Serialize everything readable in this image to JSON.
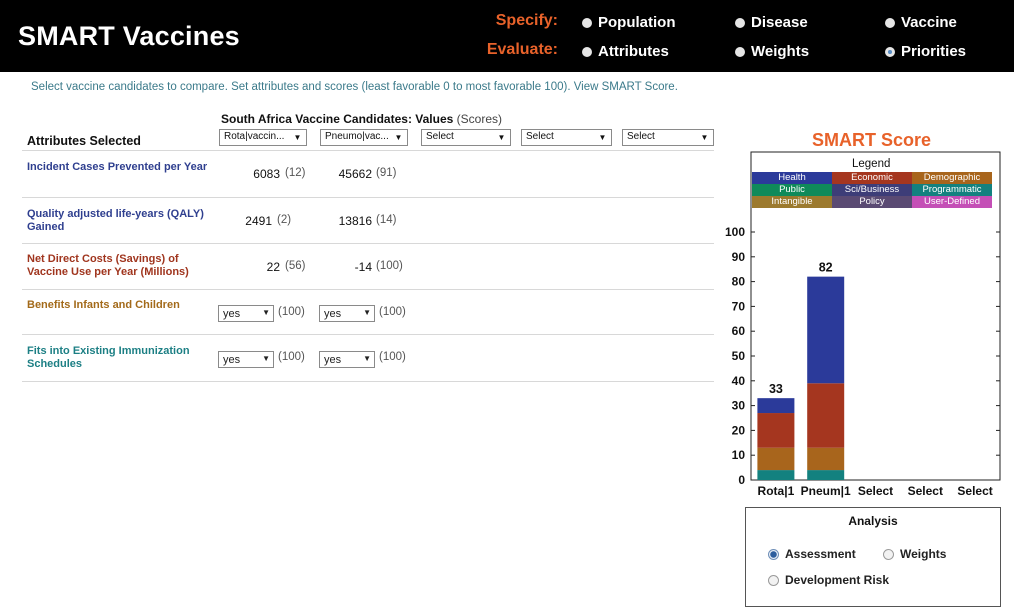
{
  "header": {
    "title": "SMART Vaccines",
    "specify_label": "Specify:",
    "evaluate_label": "Evaluate:",
    "specify_items": [
      "Population",
      "Disease",
      "Vaccine"
    ],
    "evaluate_items": [
      "Attributes",
      "Weights",
      "Priorities"
    ],
    "selected": "Priorities"
  },
  "instructions": "Select vaccine candidates to compare. Set attributes and scores (least favorable 0 to most favorable 100). View SMART Score.",
  "table": {
    "title": "South Africa Vaccine Candidates: Values",
    "title_sub": "(Scores)",
    "attributes_header": "Attributes Selected",
    "candidate_selects": [
      "Rota|vaccin...",
      "Pneumo|vac...",
      "Select",
      "Select",
      "Select"
    ],
    "rows": [
      {
        "label": "Incident Cases Prevented per Year",
        "color": "#2f3f8f",
        "v1": "6083",
        "s1": "(12)",
        "v2": "45662",
        "s2": "(91)"
      },
      {
        "label": "Quality adjusted life-years (QALY) Gained",
        "color": "#2f3f8f",
        "v1": "2491",
        "s1": "(2)",
        "v2": "13816",
        "s2": "(14)"
      },
      {
        "label": "Net Direct Costs (Savings) of Vaccine Use per Year (Millions)",
        "color": "#a0351e",
        "v1": "22",
        "s1": "(56)",
        "v2": "-14",
        "s2": "(100)"
      },
      {
        "label": "Benefits Infants and Children",
        "color": "#a36a1a",
        "v1": "yes",
        "s1": "(100)",
        "v2": "yes",
        "s2": "(100)"
      },
      {
        "label": "Fits into Existing Immunization Schedules",
        "color": "#1c7f84",
        "v1": "yes",
        "s1": "(100)",
        "v2": "yes",
        "s2": "(100)"
      }
    ]
  },
  "smart": {
    "title": "SMART Score",
    "legend_title": "Legend",
    "legend": [
      {
        "name": "Health",
        "color": "#2b3a9a"
      },
      {
        "name": "Economic",
        "color": "#a5361f"
      },
      {
        "name": "Demographic",
        "color": "#a8651c"
      },
      {
        "name": "Public",
        "color": "#0f8a5a"
      },
      {
        "name": "Sci/Business",
        "color": "#3d3d78"
      },
      {
        "name": "Programmatic",
        "color": "#13817f"
      },
      {
        "name": "Intangible",
        "color": "#9c7a2e"
      },
      {
        "name": "Policy",
        "color": "#5a4a73"
      },
      {
        "name": "User-Defined",
        "color": "#c44fb6"
      }
    ]
  },
  "chart_data": {
    "type": "bar",
    "title": "SMART Score",
    "categories": [
      "Rota|1",
      "Pneum|1",
      "Select",
      "Select",
      "Select"
    ],
    "ylim": [
      0,
      100
    ],
    "yticks": [
      0,
      10,
      20,
      30,
      40,
      50,
      60,
      70,
      80,
      90,
      100
    ],
    "totals": [
      33,
      82,
      null,
      null,
      null
    ],
    "total_labels": [
      "33",
      "82",
      "",
      "",
      ""
    ],
    "series": [
      {
        "name": "Programmatic",
        "color": "#13817f",
        "values": [
          4,
          4,
          0,
          0,
          0
        ]
      },
      {
        "name": "Demographic",
        "color": "#a8651c",
        "values": [
          9,
          9,
          0,
          0,
          0
        ]
      },
      {
        "name": "Economic",
        "color": "#a5361f",
        "values": [
          14,
          26,
          0,
          0,
          0
        ]
      },
      {
        "name": "Health",
        "color": "#2b3a9a",
        "values": [
          6,
          43,
          0,
          0,
          0
        ]
      }
    ]
  },
  "analysis": {
    "title": "Analysis",
    "options": [
      "Assessment",
      "Weights",
      "Development Risk"
    ],
    "selected": "Assessment"
  }
}
